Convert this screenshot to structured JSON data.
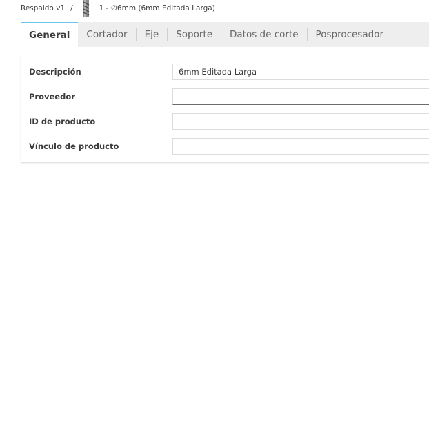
{
  "breadcrumb": {
    "root": "Respaldo v1",
    "separator": "/",
    "tool_icon": "end-mill-tool-icon",
    "current": "1 - ∅6mm (6mm Editada Larga)"
  },
  "tabs": [
    {
      "label": "General",
      "active": true
    },
    {
      "label": "Cortador",
      "active": false
    },
    {
      "label": "Eje",
      "active": false
    },
    {
      "label": "Soporte",
      "active": false
    },
    {
      "label": "Datos de corte",
      "active": false
    },
    {
      "label": "Posprocesador",
      "active": false
    }
  ],
  "form": {
    "fields": [
      {
        "label": "Descripción",
        "value": "6mm Editada Larga"
      },
      {
        "label": "Proveedor",
        "value": ""
      },
      {
        "label": "ID de producto",
        "value": ""
      },
      {
        "label": "Vínculo de producto",
        "value": ""
      }
    ]
  },
  "colors": {
    "active_tab_accent": "#6cc3e8",
    "tabbar_background": "#eeeeee"
  }
}
